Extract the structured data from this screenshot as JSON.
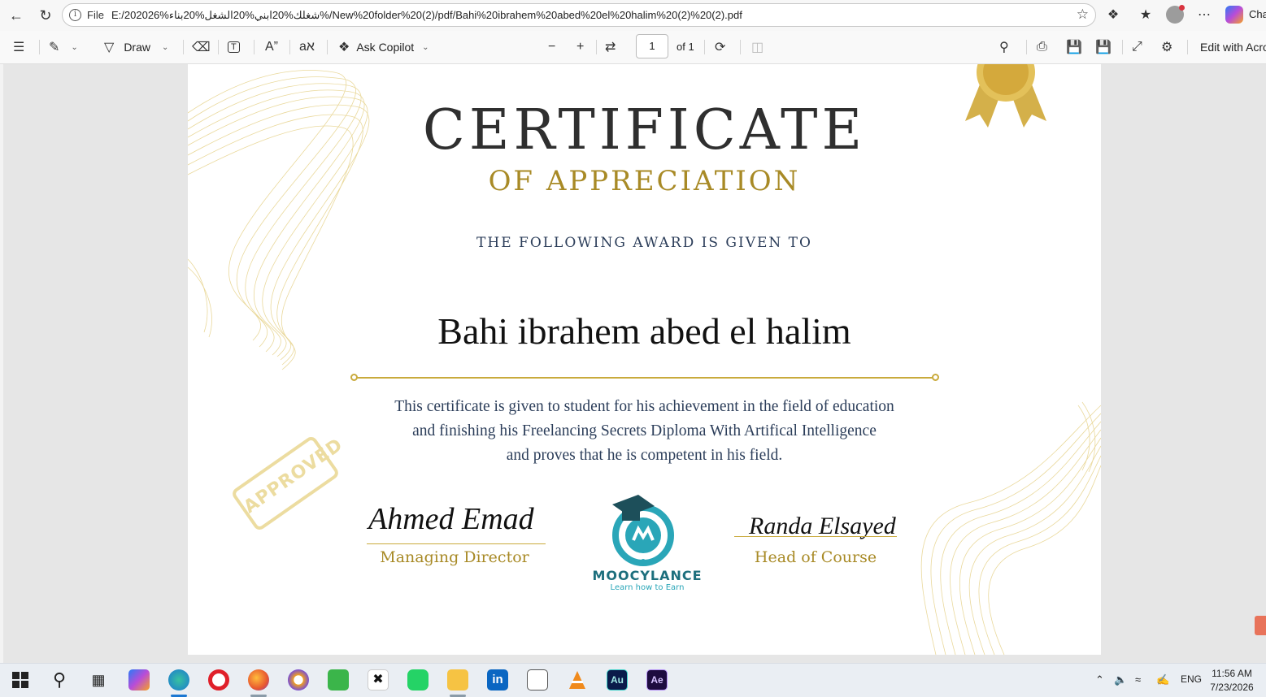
{
  "browser": {
    "url_scheme": "File",
    "url": "E:/202026%شغلك%20ابني%20الشغل%20بناء%/New%20folder%20(2)/pdf/Bahi%20ibrahem%20abed%20el%20halim%20(2)%20(2).pdf",
    "copilot_label": "Cha"
  },
  "toolbar": {
    "draw_label": "Draw",
    "ask_copilot_label": "Ask Copilot",
    "page_number": "1",
    "page_count": "of 1",
    "edit_label": "Edit with Acro"
  },
  "certificate": {
    "title": "CERTIFICATE",
    "subtitle": "OF APPRECIATION",
    "given_to": "THE FOLLOWING AWARD IS GIVEN TO",
    "recipient": "Bahi ibrahem abed el halim",
    "body_line1": "This certificate is given to student for his achievement in the field of education",
    "body_line2": "and finishing his Freelancing Secrets Diploma With Artifical Intelligence",
    "body_line3": "and proves that he is competent in his field.",
    "stamp_text": "APPROVED",
    "signer1_signature": "Ahmed Emad",
    "signer1_role": "Managing Director",
    "signer2_signature": "Randa Elsayed",
    "signer2_role": "Head of Course",
    "logo_name": "MOOCYLANCE",
    "logo_tagline": "Learn how to Earn"
  },
  "taskbar": {
    "language": "ENG",
    "time": "11:56 AM",
    "date": "7/23/2026"
  },
  "colors": {
    "gold": "#c9aa3c",
    "title": "#2f2f2f",
    "navy": "#2c3e5a",
    "teal": "#1d6f7d"
  }
}
